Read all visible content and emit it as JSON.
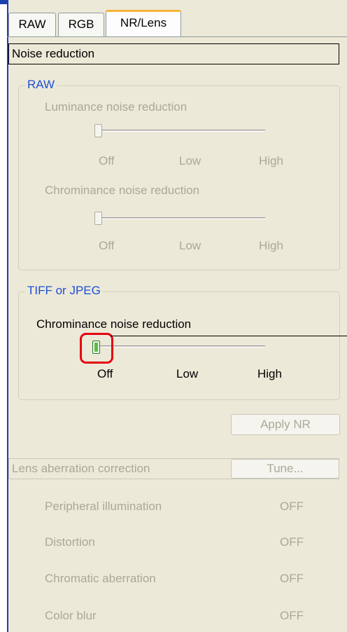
{
  "tabs": [
    {
      "label": "RAW",
      "active": false
    },
    {
      "label": "RGB",
      "active": false
    },
    {
      "label": "NR/Lens",
      "active": true
    }
  ],
  "noise_reduction": {
    "header": "Noise reduction",
    "raw_group": {
      "title": "RAW",
      "luminance": {
        "label": "Luminance noise reduction",
        "level": 0,
        "ticks": [
          "Off",
          "Low",
          "High"
        ]
      },
      "chrominance": {
        "label": "Chrominance noise reduction",
        "level": 0,
        "ticks": [
          "Off",
          "Low",
          "High"
        ]
      }
    },
    "tiff_group": {
      "title": "TIFF or JPEG",
      "chrominance": {
        "label": "Chrominance noise reduction",
        "level": 0,
        "ticks": [
          "Off",
          "Low",
          "High"
        ]
      }
    },
    "apply_button": "Apply NR"
  },
  "lens": {
    "header": "Lens aberration correction",
    "tune_button": "Tune...",
    "rows": [
      {
        "label": "Peripheral illumination",
        "value": "OFF"
      },
      {
        "label": "Distortion",
        "value": "OFF"
      },
      {
        "label": "Chromatic aberration",
        "value": "OFF"
      },
      {
        "label": "Color blur",
        "value": "OFF"
      }
    ]
  },
  "colors": {
    "window_border": "#1d3fb0",
    "panel_bg": "#ece9d8",
    "group_title": "#1d4fd8",
    "disabled_text": "#aca899",
    "highlight": "#e60012",
    "active_tab_accent": "#f6b43a"
  }
}
